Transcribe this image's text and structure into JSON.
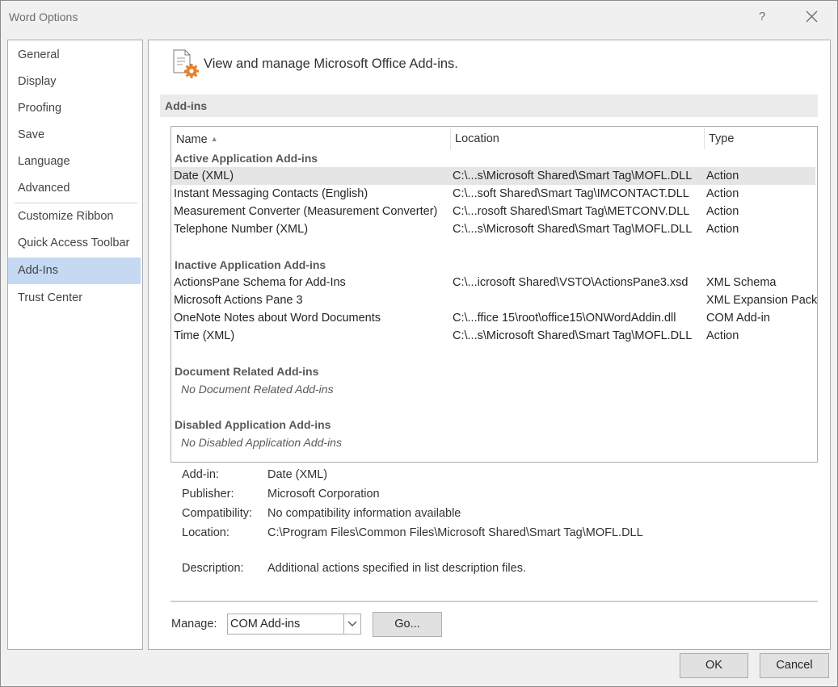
{
  "window": {
    "title": "Word Options",
    "help_glyph": "?"
  },
  "nav": {
    "items": [
      {
        "label": "General"
      },
      {
        "label": "Display"
      },
      {
        "label": "Proofing"
      },
      {
        "label": "Save"
      },
      {
        "label": "Language"
      },
      {
        "label": "Advanced"
      },
      {
        "label": "Customize Ribbon"
      },
      {
        "label": "Quick Access Toolbar"
      },
      {
        "label": "Add-Ins",
        "active": true
      },
      {
        "label": "Trust Center"
      }
    ]
  },
  "header": {
    "text": "View and manage Microsoft Office Add-ins.",
    "icon": "addins-gear-icon"
  },
  "section": {
    "title": "Add-ins"
  },
  "table": {
    "columns": [
      "Name",
      "Location",
      "Type"
    ],
    "sort": {
      "column": "Name",
      "direction": "ascending"
    },
    "groups": [
      {
        "title": "Active Application Add-ins",
        "rows": [
          {
            "name": "Date (XML)",
            "location": "C:\\...s\\Microsoft Shared\\Smart Tag\\MOFL.DLL",
            "type": "Action",
            "selected": true
          },
          {
            "name": "Instant Messaging Contacts (English)",
            "location": "C:\\...soft Shared\\Smart Tag\\IMCONTACT.DLL",
            "type": "Action"
          },
          {
            "name": "Measurement Converter (Measurement Converter)",
            "location": "C:\\...rosoft Shared\\Smart Tag\\METCONV.DLL",
            "type": "Action"
          },
          {
            "name": "Telephone Number (XML)",
            "location": "C:\\...s\\Microsoft Shared\\Smart Tag\\MOFL.DLL",
            "type": "Action"
          }
        ]
      },
      {
        "title": "Inactive Application Add-ins",
        "rows": [
          {
            "name": "ActionsPane Schema for Add-Ins",
            "location": "C:\\...icrosoft Shared\\VSTO\\ActionsPane3.xsd",
            "type": "XML Schema"
          },
          {
            "name": "Microsoft Actions Pane 3",
            "location": "",
            "type": "XML Expansion Pack"
          },
          {
            "name": "OneNote Notes about Word Documents",
            "location": "C:\\...ffice 15\\root\\office15\\ONWordAddin.dll",
            "type": "COM Add-in"
          },
          {
            "name": "Time (XML)",
            "location": "C:\\...s\\Microsoft Shared\\Smart Tag\\MOFL.DLL",
            "type": "Action"
          }
        ]
      },
      {
        "title": "Document Related Add-ins",
        "empty": "No Document Related Add-ins"
      },
      {
        "title": "Disabled Application Add-ins",
        "empty": "No Disabled Application Add-ins"
      }
    ]
  },
  "details": {
    "addin_label": "Add-in:",
    "addin_value": "Date (XML)",
    "publisher_label": "Publisher:",
    "publisher_value": "Microsoft Corporation",
    "compat_label": "Compatibility:",
    "compat_value": "No compatibility information available",
    "location_label": "Location:",
    "location_value": "C:\\Program Files\\Common Files\\Microsoft Shared\\Smart Tag\\MOFL.DLL",
    "description_label": "Description:",
    "description_value": "Additional actions specified in list description files."
  },
  "manage": {
    "label": "Manage:",
    "selected": "COM Add-ins",
    "go_label": "Go..."
  },
  "footer": {
    "ok_label": "OK",
    "cancel_label": "Cancel"
  }
}
